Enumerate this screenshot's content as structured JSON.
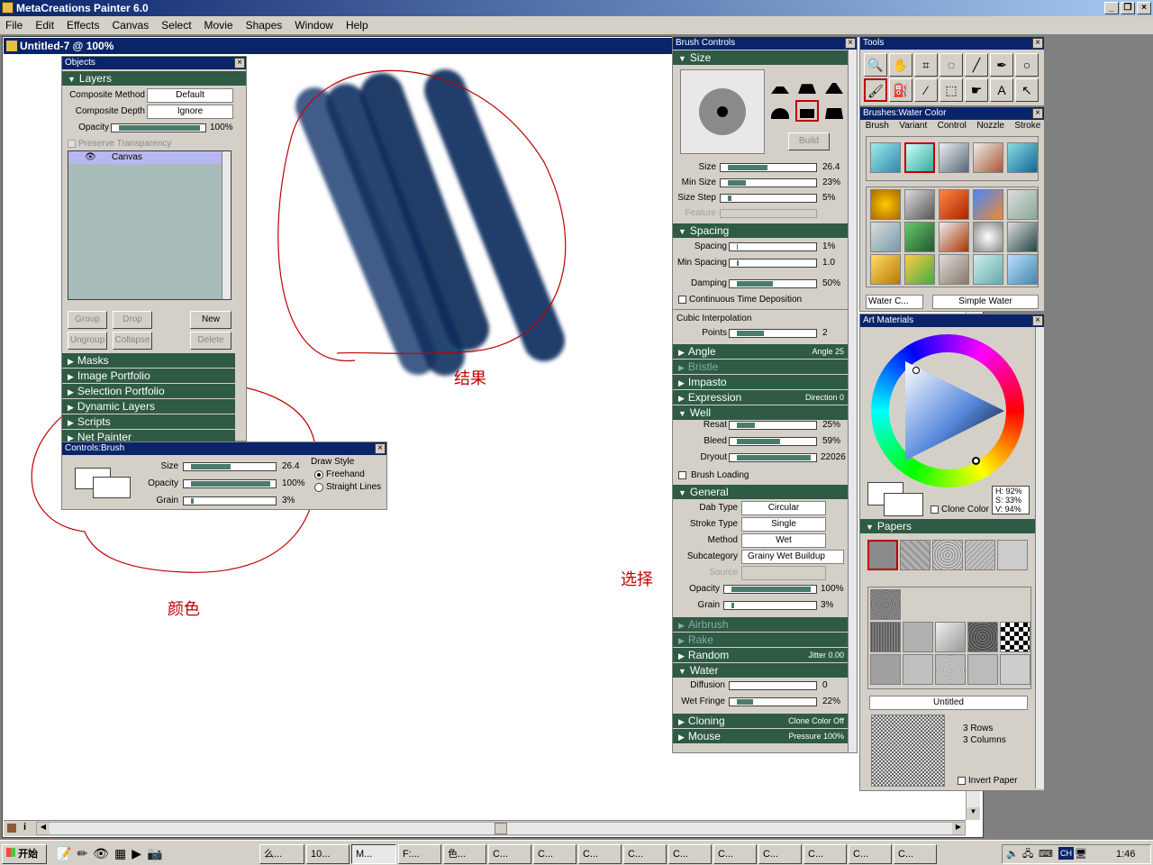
{
  "app": {
    "title": "MetaCreations Painter 6.0"
  },
  "menu": [
    "File",
    "Edit",
    "Effects",
    "Canvas",
    "Select",
    "Movie",
    "Shapes",
    "Window",
    "Help"
  ],
  "document": {
    "title": "Untitled-7 @ 100%"
  },
  "objects": {
    "title": "Objects",
    "layers_label": "Layers",
    "composite_method_label": "Composite Method",
    "composite_method": "Default",
    "composite_depth_label": "Composite Depth",
    "composite_depth": "Ignore",
    "opacity_label": "Opacity",
    "opacity_value": "100%",
    "opacity_level": 1.0,
    "preserve_label": "Preserve Transparency",
    "layer_item": "Canvas",
    "buttons": {
      "group": "Group",
      "drop": "Drop",
      "new": "New",
      "ungroup": "Ungroup",
      "collapse": "Collapse",
      "delete": "Delete"
    },
    "sections": [
      "Masks",
      "Image Portfolio",
      "Selection Portfolio",
      "Dynamic Layers",
      "Scripts",
      "Net Painter"
    ]
  },
  "controls_brush": {
    "title": "Controls:Brush",
    "size_label": "Size",
    "size_value": "26.4",
    "opacity_label": "Opacity",
    "opacity_value": "100%",
    "grain_label": "Grain",
    "grain_value": "3%",
    "draw_style_label": "Draw Style",
    "freehand": "Freehand",
    "straight_lines": "Straight Lines"
  },
  "brush_controls": {
    "title": "Brush Controls",
    "size_section": "Size",
    "build_button": "Build",
    "size_label": "Size",
    "size_value": "26.4",
    "min_size_label": "Min Size",
    "min_size_value": "23%",
    "size_step_label": "Size Step",
    "size_step_value": "5%",
    "feature_label": "Feature",
    "spacing_section": "Spacing",
    "spacing_label": "Spacing",
    "spacing_value": "1%",
    "min_spacing_label": "Min Spacing",
    "min_spacing_value": "1.0",
    "damping_label": "Damping",
    "damping_value": "50%",
    "continuous_label": "Continuous Time Deposition",
    "cubic_label": "Cubic Interpolation",
    "points_label": "Points",
    "points_value": "2",
    "angle_section": "Angle",
    "angle_right": "Angle 25",
    "bristle_section": "Bristle",
    "impasto_section": "Impasto",
    "expression_section": "Expression",
    "expression_right": "Direction 0",
    "well_section": "Well",
    "resat_label": "Resat",
    "resat_value": "25%",
    "bleed_label": "Bleed",
    "bleed_value": "59%",
    "dryout_label": "Dryout",
    "dryout_value": "22026",
    "brush_loading_label": "Brush Loading",
    "general_section": "General",
    "dab_type_label": "Dab Type",
    "dab_type": "Circular",
    "stroke_type_label": "Stroke Type",
    "stroke_type": "Single",
    "method_label": "Method",
    "method": "Wet",
    "subcategory_label": "Subcategory",
    "subcategory": "Grainy Wet Buildup",
    "source_label": "Source",
    "opacity_label": "Opacity",
    "opacity_value": "100%",
    "grain_label": "Grain",
    "grain_value": "3%",
    "airbrush_section": "Airbrush",
    "rake_section": "Rake",
    "random_section": "Random",
    "random_right": "Jitter 0.00",
    "water_section": "Water",
    "diffusion_label": "Diffusion",
    "diffusion_value": "0",
    "wet_fringe_label": "Wet Fringe",
    "wet_fringe_value": "22%",
    "cloning_section": "Cloning",
    "cloning_right": "Clone Color Off",
    "mouse_section": "Mouse",
    "mouse_right": "Pressure 100%"
  },
  "tools": {
    "title": "Tools"
  },
  "brushes": {
    "title": "Brushes:Water Color",
    "tabs": [
      "Brush",
      "Variant",
      "Control",
      "Nozzle",
      "Stroke"
    ],
    "category": "Water C...",
    "variant": "Simple Water"
  },
  "art_materials": {
    "title": "Art Materials",
    "h": "H: 92%",
    "s": "S: 33%",
    "v": "V: 94%",
    "clone_color": "Clone Color",
    "papers_section": "Papers",
    "paper_name": "Untitled",
    "rows": "3 Rows",
    "columns": "3 Columns",
    "invert_paper": "Invert Paper"
  },
  "annotations": {
    "result": "结果",
    "color": "颜色",
    "select": "选择"
  },
  "taskbar": {
    "start": "开始",
    "items": [
      "么...",
      "10...",
      "M...",
      "F:...",
      "色...",
      "C...",
      "C...",
      "C...",
      "C...",
      "C...",
      "C...",
      "C...",
      "C...",
      "C...",
      "C..."
    ],
    "tray_lang": "CH",
    "time": "1:46"
  },
  "colors": {
    "title_blue": "#0a246a",
    "section_green": "#2f5a44",
    "annotation_red": "#c00000",
    "brush_stroke": "#0d2a5a"
  }
}
